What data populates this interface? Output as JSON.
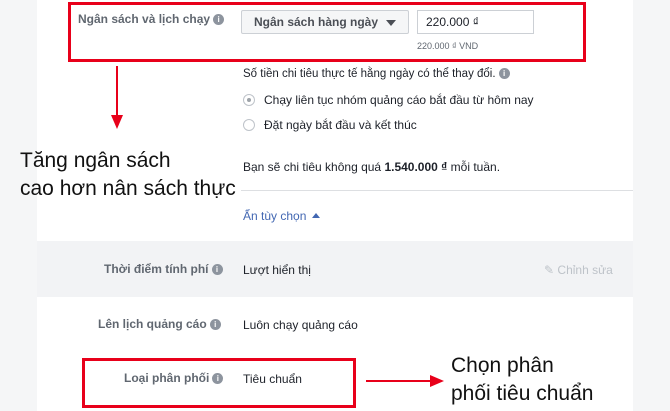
{
  "budget": {
    "label": "Ngân sách và lịch chạy",
    "dropdown": "Ngân sách hàng ngày",
    "amount": "220.000 ₫",
    "amount_note": "220.000 ₫ VND",
    "daily_note": "Số tiền chi tiêu thực tế hằng ngày có thể thay đổi.",
    "options": [
      {
        "label": "Chạy liên tục nhóm quảng cáo bắt đầu từ hôm nay",
        "selected": true
      },
      {
        "label": "Đặt ngày bắt đầu và kết thúc",
        "selected": false
      }
    ],
    "weekly_prefix": "Bạn sẽ chi tiêu không quá ",
    "weekly_amount": "1.540.000 ₫",
    "weekly_suffix": " mỗi tuần.",
    "hide_options": "Ẩn tùy chọn"
  },
  "billing": {
    "label": "Thời điểm tính phí",
    "value": "Lượt hiển thị",
    "edit": "Chỉnh sửa"
  },
  "schedule": {
    "label": "Lên lịch quảng cáo",
    "value": "Luôn chạy quảng cáo"
  },
  "delivery": {
    "label": "Loại phân phối",
    "value": "Tiêu chuẩn"
  },
  "annotations": {
    "left_line1": "Tăng ngân sách",
    "left_line2": "cao hơn nân sách thực",
    "right_line1": "Chọn phân",
    "right_line2": "phối tiêu chuẩn"
  },
  "colors": {
    "highlight": "#e8001a",
    "panel_bg": "#ffffff",
    "page_bg": "#f5f6f7"
  }
}
